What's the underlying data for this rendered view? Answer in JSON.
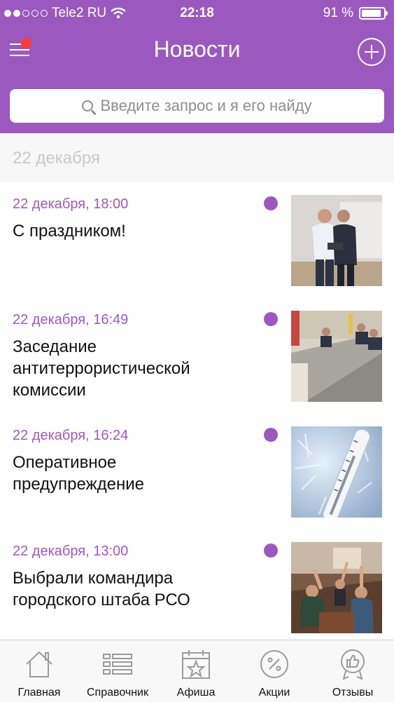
{
  "status_bar": {
    "carrier": "Tele2 RU",
    "time": "22:18",
    "battery": "91 %",
    "battery_level": 0.91
  },
  "header": {
    "title": "Новости"
  },
  "search": {
    "placeholder": "Введите запрос и я его найду"
  },
  "section": {
    "date": "22 декабря"
  },
  "news": [
    {
      "date": "22 декабря, 18:00",
      "title": "С праздником!",
      "unread": true,
      "image": "award-ceremony-photo"
    },
    {
      "date": "22 декабря, 16:49",
      "title": "Заседание антитеррористической комиссии",
      "unread": true,
      "image": "meeting-room-photo"
    },
    {
      "date": "22 декабря, 16:24",
      "title": "Оперативное предупреждение",
      "unread": true,
      "image": "frost-thermometer-photo"
    },
    {
      "date": "22 декабря, 13:00",
      "title": "Выбрали командира городского штаба РСО",
      "unread": true,
      "image": "voting-hands-photo"
    }
  ],
  "tabs": [
    {
      "label": "Главная",
      "icon": "house-icon"
    },
    {
      "label": "Справочник",
      "icon": "list-icon"
    },
    {
      "label": "Афиша",
      "icon": "calendar-star-icon"
    },
    {
      "label": "Акции",
      "icon": "percent-icon"
    },
    {
      "label": "Отзывы",
      "icon": "thumbs-up-badge-icon"
    }
  ],
  "colors": {
    "accent": "#9b59c0",
    "badge": "#ff3b30",
    "tab_icon": "#9a9a9a"
  }
}
